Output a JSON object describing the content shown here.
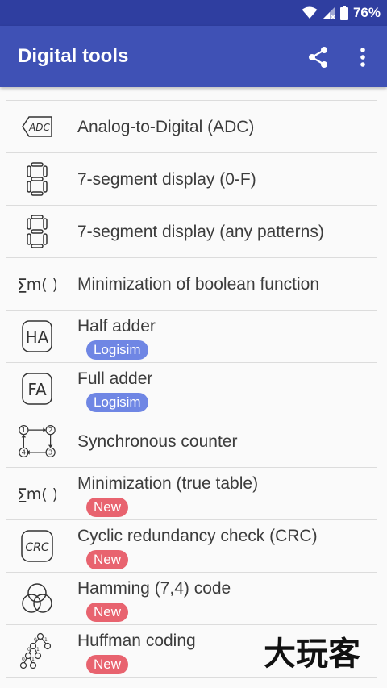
{
  "status_bar": {
    "battery_percent": "76%",
    "icons": [
      "wifi-icon",
      "signal-icon",
      "battery-icon"
    ]
  },
  "app_bar": {
    "title": "Digital tools",
    "actions": [
      "share-icon",
      "more-vert-icon"
    ]
  },
  "colors": {
    "primary": "#3f51b5",
    "status_bar": "#2f3ea0",
    "badge_logisim": "#6f86e4",
    "badge_new": "#e8636f"
  },
  "list": {
    "items": [
      {
        "label": "Analog-to-Digital (ADC)",
        "icon": "adc-icon"
      },
      {
        "label": "7-segment display (0-F)",
        "icon": "seven-segment-icon"
      },
      {
        "label": "7-segment display (any patterns)",
        "icon": "seven-segment-icon"
      },
      {
        "label": "Minimization of boolean function",
        "icon": "sum-minterms-icon"
      },
      {
        "label": "Half adder",
        "icon": "half-adder-icon",
        "badge": "Logisim"
      },
      {
        "label": "Full adder",
        "icon": "full-adder-icon",
        "badge": "Logisim"
      },
      {
        "label": "Synchronous counter",
        "icon": "counter-icon"
      },
      {
        "label": "Minimization (true table)",
        "icon": "sum-minterms-icon",
        "badge": "New"
      },
      {
        "label": "Cyclic redundancy check (CRC)",
        "icon": "crc-icon",
        "badge": "New"
      },
      {
        "label": "Hamming (7,4) code",
        "icon": "hamming-icon",
        "badge": "New"
      },
      {
        "label": "Huffman coding",
        "icon": "huffman-tree-icon",
        "badge": "New"
      }
    ]
  },
  "watermark": {
    "text": "大玩客"
  }
}
